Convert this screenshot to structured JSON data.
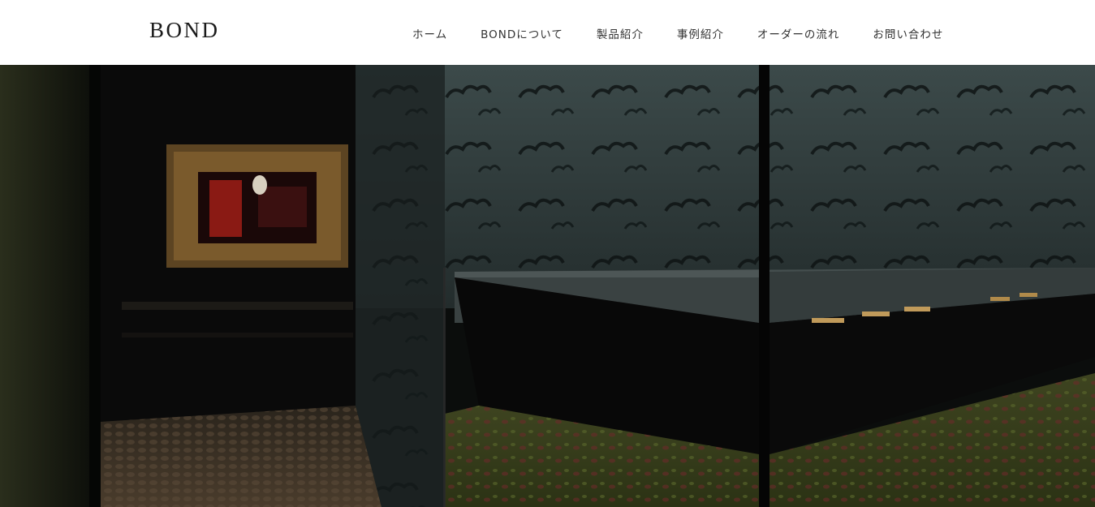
{
  "header": {
    "logo": "BOND",
    "nav": [
      {
        "label": "ホーム"
      },
      {
        "label": "BONDについて"
      },
      {
        "label": "製品紹介"
      },
      {
        "label": "事例紹介"
      },
      {
        "label": "オーダーの流れ"
      },
      {
        "label": "お問い合わせ"
      }
    ]
  },
  "hero": {
    "image": "dark-interior-showroom-photo"
  },
  "colors": {
    "background": "#ffffff",
    "text": "#333333",
    "logo": "#1a1a1a"
  }
}
